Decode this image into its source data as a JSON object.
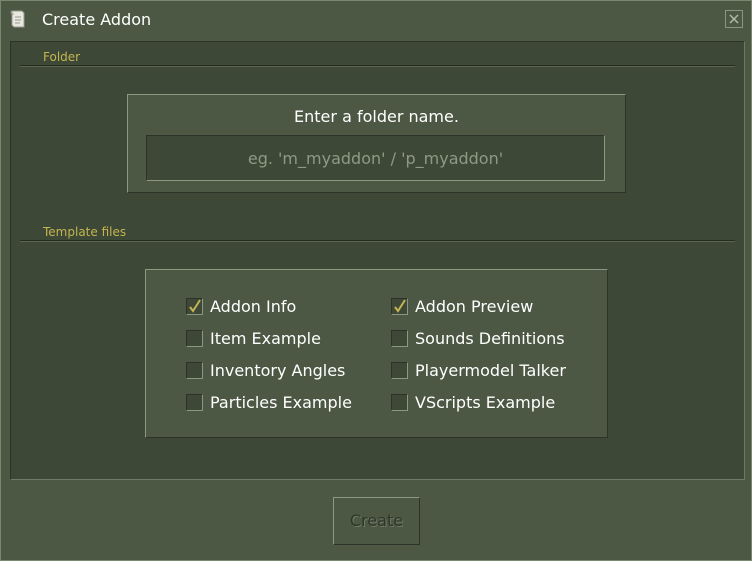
{
  "window": {
    "title": "Create Addon",
    "app_icon": "scroll-icon",
    "close_icon": "close-icon"
  },
  "folder": {
    "section_label": "Folder",
    "prompt": "Enter a folder name.",
    "input_value": "",
    "input_placeholder": "eg. 'm_myaddon' / 'p_myaddon'"
  },
  "templates": {
    "section_label": "Template files",
    "items": [
      {
        "label": "Addon Info",
        "checked": true
      },
      {
        "label": "Addon Preview",
        "checked": true
      },
      {
        "label": "Item Example",
        "checked": false
      },
      {
        "label": "Sounds Definitions",
        "checked": false
      },
      {
        "label": "Inventory Angles",
        "checked": false
      },
      {
        "label": "Playermodel Talker",
        "checked": false
      },
      {
        "label": "Particles Example",
        "checked": false
      },
      {
        "label": "VScripts Example",
        "checked": false
      }
    ]
  },
  "actions": {
    "create_label": "Create",
    "create_enabled": false
  },
  "colors": {
    "background": "#4c5844",
    "panel": "#3e4837",
    "accent_label": "#c4b550",
    "checkmark": "#c4b550",
    "text": "#ffffff",
    "disabled_text": "#2e352a"
  }
}
